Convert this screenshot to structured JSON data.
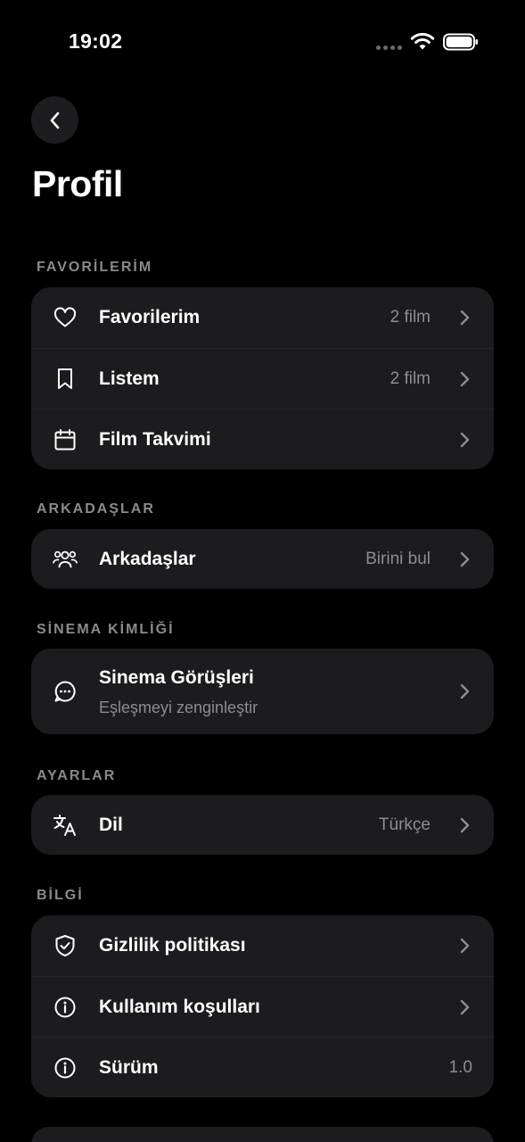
{
  "status_bar": {
    "time": "19:02"
  },
  "page": {
    "title": "Profil"
  },
  "sections": {
    "favorites": {
      "header": "FAVORİLERİM",
      "rows": [
        {
          "label": "Favorilerim",
          "value": "2 film",
          "icon": "heart-icon"
        },
        {
          "label": "Listem",
          "value": "2 film",
          "icon": "bookmark-icon"
        },
        {
          "label": "Film Takvimi",
          "value": "",
          "icon": "calendar-icon"
        }
      ]
    },
    "friends": {
      "header": "ARKADAŞLAR",
      "rows": [
        {
          "label": "Arkadaşlar",
          "value": "Birini bul",
          "icon": "friends-icon"
        }
      ]
    },
    "cinema": {
      "header": "SİNEMA KİMLİĞİ",
      "rows": [
        {
          "label": "Sinema Görüşleri",
          "subtitle": "Eşleşmeyi zenginleştir",
          "icon": "chat-bubble-icon"
        }
      ]
    },
    "settings": {
      "header": "AYARLAR",
      "rows": [
        {
          "label": "Dil",
          "value": "Türkçe",
          "icon": "translate-icon"
        }
      ]
    },
    "info": {
      "header": "BİLGİ",
      "rows": [
        {
          "label": "Gizlilik politikası",
          "icon": "shield-check-icon"
        },
        {
          "label": "Kullanım koşulları",
          "icon": "info-icon"
        },
        {
          "label": "Sürüm",
          "value": "1.0",
          "icon": "info-icon"
        }
      ]
    }
  },
  "colors": {
    "background": "#000000",
    "card": "#1c1c1e",
    "secondary_text": "#8d8d92",
    "section_header": "#8a8a8e"
  }
}
